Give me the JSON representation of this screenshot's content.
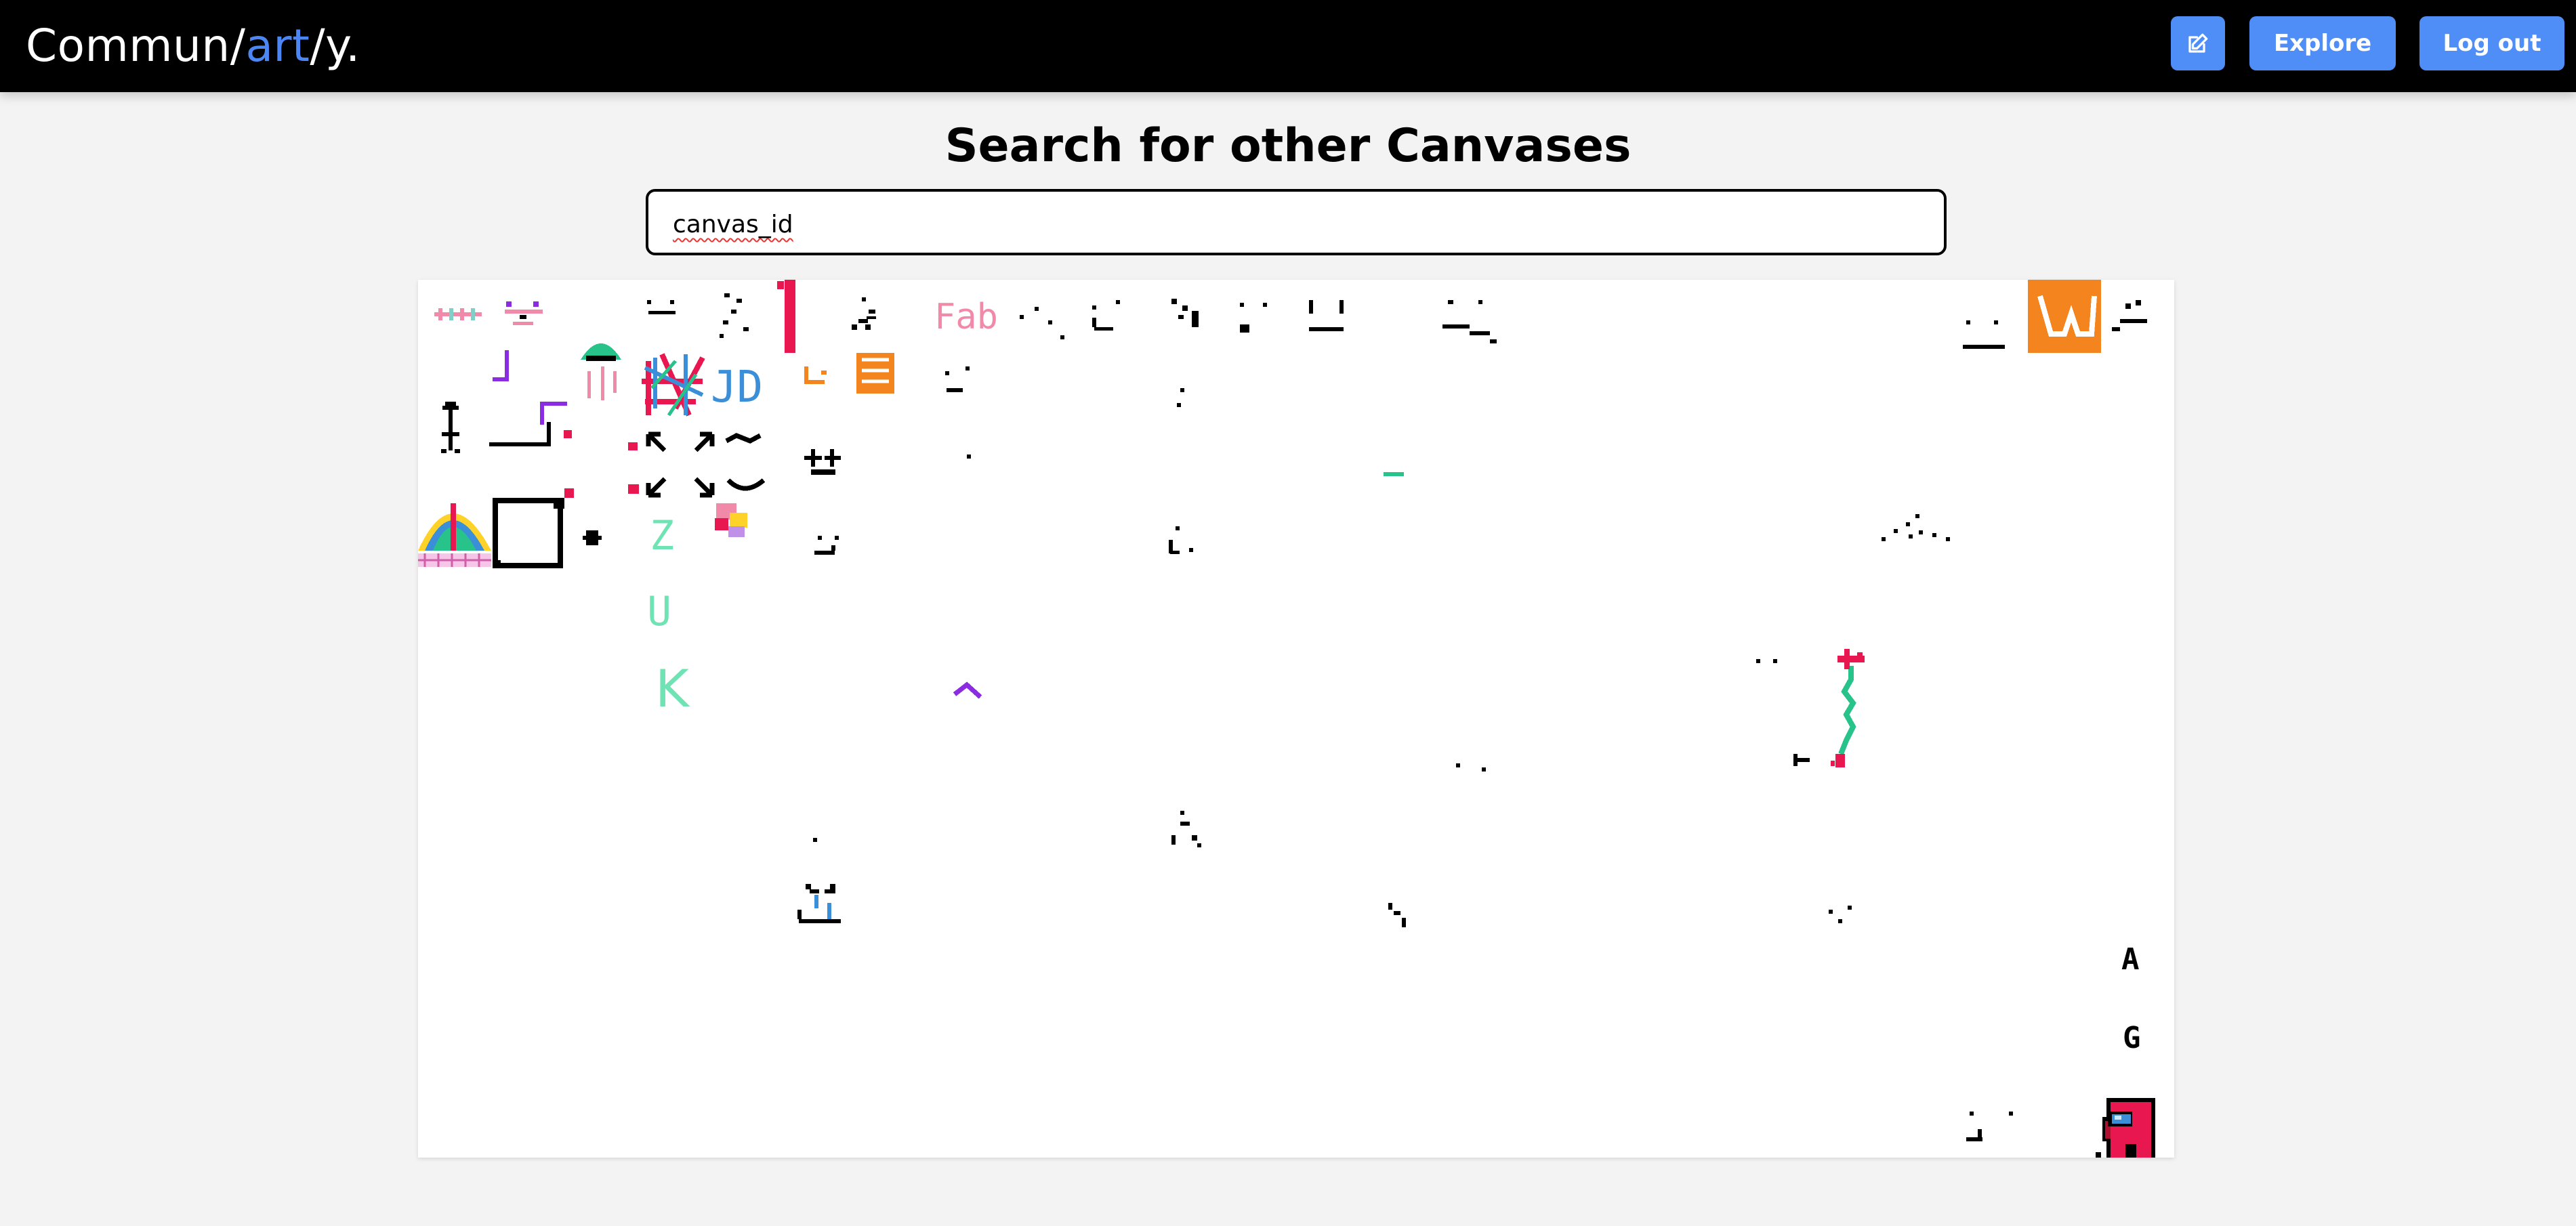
{
  "navbar": {
    "brand_part1": "Commun/",
    "brand_accent": "art",
    "brand_part2": "/y.",
    "accent_color": "#4c86f4",
    "edit_icon": "edit-icon",
    "explore_label": "Explore",
    "logout_label": "Log out",
    "button_color": "#4f8ef7"
  },
  "main": {
    "title": "Search for other Canvases",
    "search_value": "canvas_id"
  },
  "canvas": {
    "labels": {
      "fab": "Fab",
      "jd": "JD",
      "z": "Z",
      "u": "U",
      "k": "K",
      "a": "A",
      "g": "G"
    },
    "colors": [
      "#000000",
      "#e8174f",
      "#f3841e",
      "#8b2be2",
      "#3a8fd8",
      "#28c28b",
      "#f08aa8",
      "#6fe3b3",
      "#ffd22a"
    ]
  }
}
